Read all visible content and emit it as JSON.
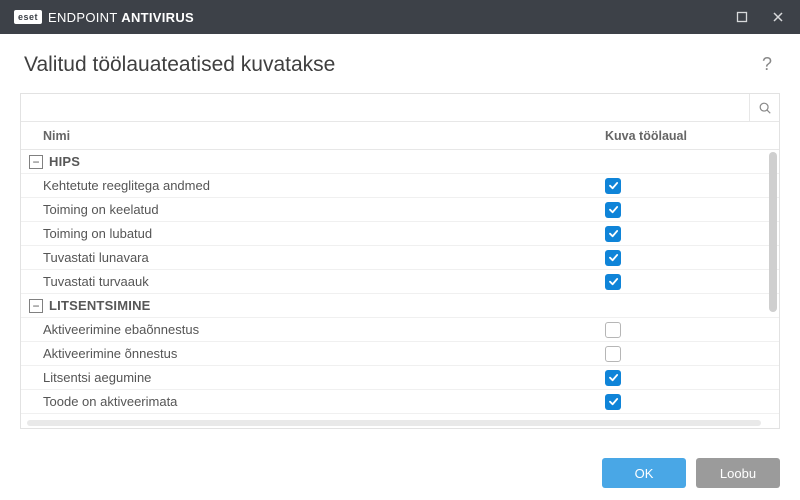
{
  "app": {
    "brand_tag": "eset",
    "brand_name_light": "ENDPOINT ",
    "brand_name_bold": "ANTIVIRUS"
  },
  "page": {
    "title": "Valitud töölauateatised kuvatakse",
    "help_label": "?"
  },
  "search": {
    "value": "",
    "placeholder": ""
  },
  "columns": {
    "name": "Nimi",
    "show": "Kuva töölaual"
  },
  "groups": [
    {
      "label": "HIPS",
      "expanded": true,
      "items": [
        {
          "label": "Kehtetute reeglitega andmed",
          "checked": true
        },
        {
          "label": "Toiming on keelatud",
          "checked": true
        },
        {
          "label": "Toiming on lubatud",
          "checked": true
        },
        {
          "label": "Tuvastati lunavara",
          "checked": true
        },
        {
          "label": "Tuvastati turvaauk",
          "checked": true
        }
      ]
    },
    {
      "label": "LITSENTSIMINE",
      "expanded": true,
      "items": [
        {
          "label": "Aktiveerimine ebaõnnestus",
          "checked": false
        },
        {
          "label": "Aktiveerimine õnnestus",
          "checked": false
        },
        {
          "label": "Litsentsi aegumine",
          "checked": true
        },
        {
          "label": "Toode on aktiveerimata",
          "checked": true
        }
      ]
    }
  ],
  "footer": {
    "ok": "OK",
    "cancel": "Loobu"
  },
  "icons": {
    "collapse_glyph": "−"
  }
}
